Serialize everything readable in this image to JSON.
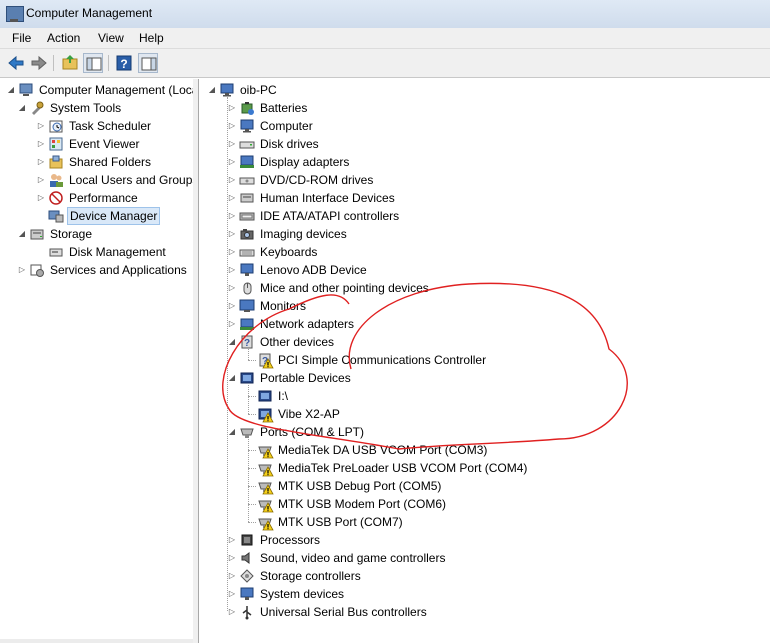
{
  "window": {
    "title": "Computer Management"
  },
  "menu": [
    "File",
    "Action",
    "View",
    "Help"
  ],
  "left_tree": [
    {
      "label": "Computer Management (Local",
      "icon": "computer-management-icon",
      "level": 0,
      "arrow": "expanded"
    },
    {
      "label": "System Tools",
      "icon": "system-tools-icon",
      "level": 1,
      "arrow": "expanded"
    },
    {
      "label": "Task Scheduler",
      "icon": "task-scheduler-icon",
      "level": 2,
      "arrow": "collapsed"
    },
    {
      "label": "Event Viewer",
      "icon": "event-viewer-icon",
      "level": 2,
      "arrow": "collapsed"
    },
    {
      "label": "Shared Folders",
      "icon": "shared-folders-icon",
      "level": 2,
      "arrow": "collapsed"
    },
    {
      "label": "Local Users and Groups",
      "icon": "users-icon",
      "level": 2,
      "arrow": "collapsed"
    },
    {
      "label": "Performance",
      "icon": "performance-icon",
      "level": 2,
      "arrow": "collapsed"
    },
    {
      "label": "Device Manager",
      "icon": "device-manager-icon",
      "level": 2,
      "arrow": "none",
      "selected": true
    },
    {
      "label": "Storage",
      "icon": "storage-icon",
      "level": 1,
      "arrow": "expanded"
    },
    {
      "label": "Disk Management",
      "icon": "disk-management-icon",
      "level": 2,
      "arrow": "none"
    },
    {
      "label": "Services and Applications",
      "icon": "services-icon",
      "level": 1,
      "arrow": "collapsed"
    }
  ],
  "device_tree": {
    "root": "oib-PC",
    "categories": [
      {
        "label": "Batteries",
        "icon": "battery-icon",
        "arrow": "collapsed"
      },
      {
        "label": "Computer",
        "icon": "computer-icon",
        "arrow": "collapsed"
      },
      {
        "label": "Disk drives",
        "icon": "disk-drive-icon",
        "arrow": "collapsed"
      },
      {
        "label": "Display adapters",
        "icon": "display-adapter-icon",
        "arrow": "collapsed"
      },
      {
        "label": "DVD/CD-ROM drives",
        "icon": "dvd-drive-icon",
        "arrow": "collapsed"
      },
      {
        "label": "Human Interface Devices",
        "icon": "hid-icon",
        "arrow": "collapsed"
      },
      {
        "label": "IDE ATA/ATAPI controllers",
        "icon": "ide-controller-icon",
        "arrow": "collapsed"
      },
      {
        "label": "Imaging devices",
        "icon": "camera-icon",
        "arrow": "collapsed"
      },
      {
        "label": "Keyboards",
        "icon": "keyboard-icon",
        "arrow": "collapsed"
      },
      {
        "label": "Lenovo ADB Device",
        "icon": "adb-device-icon",
        "arrow": "collapsed"
      },
      {
        "label": "Mice and other pointing devices",
        "icon": "mouse-icon",
        "arrow": "collapsed"
      },
      {
        "label": "Monitors",
        "icon": "monitor-icon",
        "arrow": "collapsed"
      },
      {
        "label": "Network adapters",
        "icon": "network-adapter-icon",
        "arrow": "collapsed"
      },
      {
        "label": "Other devices",
        "icon": "other-devices-icon",
        "arrow": "expanded",
        "children": [
          {
            "label": "PCI Simple Communications Controller",
            "icon": "unknown-device-warning-icon"
          }
        ]
      },
      {
        "label": "Portable Devices",
        "icon": "portable-device-icon",
        "arrow": "expanded",
        "children": [
          {
            "label": "I:\\",
            "icon": "portable-device-icon"
          },
          {
            "label": "Vibe X2-AP",
            "icon": "portable-device-warning-icon"
          }
        ]
      },
      {
        "label": "Ports (COM & LPT)",
        "icon": "port-icon",
        "arrow": "expanded",
        "children": [
          {
            "label": "MediaTek DA USB VCOM Port (COM3)",
            "icon": "port-warning-icon"
          },
          {
            "label": "MediaTek PreLoader USB VCOM Port (COM4)",
            "icon": "port-warning-icon"
          },
          {
            "label": "MTK USB Debug Port (COM5)",
            "icon": "port-warning-icon"
          },
          {
            "label": "MTK USB Modem Port (COM6)",
            "icon": "port-warning-icon"
          },
          {
            "label": "MTK USB Port (COM7)",
            "icon": "port-warning-icon"
          }
        ]
      },
      {
        "label": "Processors",
        "icon": "processor-icon",
        "arrow": "collapsed"
      },
      {
        "label": "Sound, video and game controllers",
        "icon": "sound-icon",
        "arrow": "collapsed"
      },
      {
        "label": "Storage controllers",
        "icon": "storage-controller-icon",
        "arrow": "collapsed"
      },
      {
        "label": "System devices",
        "icon": "system-device-icon",
        "arrow": "collapsed"
      },
      {
        "label": "Universal Serial Bus controllers",
        "icon": "usb-icon",
        "arrow": "collapsed"
      }
    ]
  },
  "annotation": {
    "shape": "red-ellipse",
    "color": "#e02020"
  }
}
